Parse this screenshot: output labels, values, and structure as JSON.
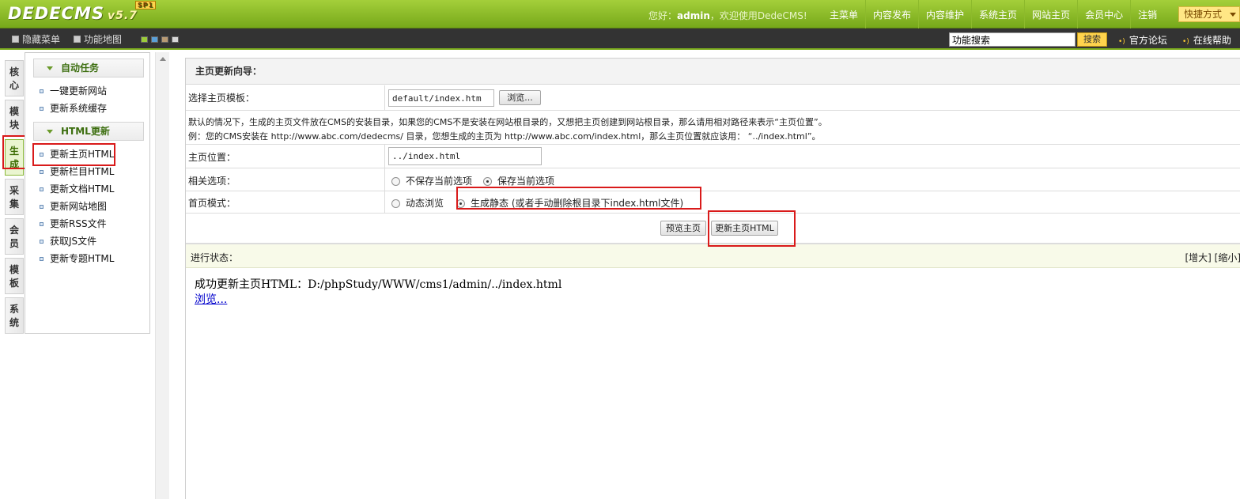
{
  "header": {
    "logo_text": "DEDECMS",
    "version": "v5.7",
    "sp_badge": "SP1",
    "welcome_prefix": "您好：",
    "username": "admin",
    "welcome_suffix": "，欢迎使用DedeCMS!",
    "nav": [
      "主菜单",
      "内容发布",
      "内容维护",
      "系统主页",
      "网站主页",
      "会员中心",
      "注销"
    ],
    "quick_label": "快捷方式"
  },
  "subbar": {
    "hide_menu": "隐藏菜单",
    "sitemap": "功能地图",
    "skin_colors": [
      "#9ccc3a",
      "#5aa0d8",
      "#b89a74",
      "#d8d8d8"
    ],
    "search_placeholder": "功能搜索",
    "search_button": "搜索",
    "forum": "官方论坛",
    "help": "在线帮助"
  },
  "vtabs": [
    "核心",
    "模块",
    "生成",
    "采集",
    "会员",
    "模板",
    "系统"
  ],
  "vtab_active": "生成",
  "menu": {
    "groups": [
      {
        "title": "自动任务",
        "items": [
          "一键更新网站",
          "更新系统缓存"
        ]
      },
      {
        "title": "HTML更新",
        "items": [
          "更新主页HTML",
          "更新栏目HTML",
          "更新文档HTML",
          "更新网站地图",
          "更新RSS文件",
          "获取JS文件",
          "更新专题HTML"
        ]
      }
    ]
  },
  "main": {
    "title": "主页更新向导：",
    "template_label": "选择主页模板：",
    "template_value": "default/index.htm",
    "browse_button": "浏览...",
    "desc_line1": "默认的情况下，生成的主页文件放在CMS的安装目录，如果您的CMS不是安装在网站根目录的，又想把主页创建到网站根目录，那么请用相对路径来表示“主页位置”。",
    "desc_line2": "例：您的CMS安装在 http://www.abc.com/dedecms/ 目录，您想生成的主页为 http://www.abc.com/index.html，那么主页位置就应该用： “../index.html”。",
    "position_label": "主页位置：",
    "position_value": "../index.html",
    "options_label": "相关选项：",
    "opt_nosave": "不保存当前选项",
    "opt_save": "保存当前选项",
    "mode_label": "首页模式：",
    "mode_dynamic": "动态浏览",
    "mode_static": "生成静态 (或者手动删除根目录下index.html文件)",
    "preview_button": "预览主页",
    "update_button": "更新主页HTML",
    "status_label": "进行状态：",
    "status_enlarge": "[增大] [缩小]",
    "result_text": "成功更新主页HTML：D:/phpStudy/WWW/cms1/admin/../index.html",
    "result_link": "浏览..."
  }
}
